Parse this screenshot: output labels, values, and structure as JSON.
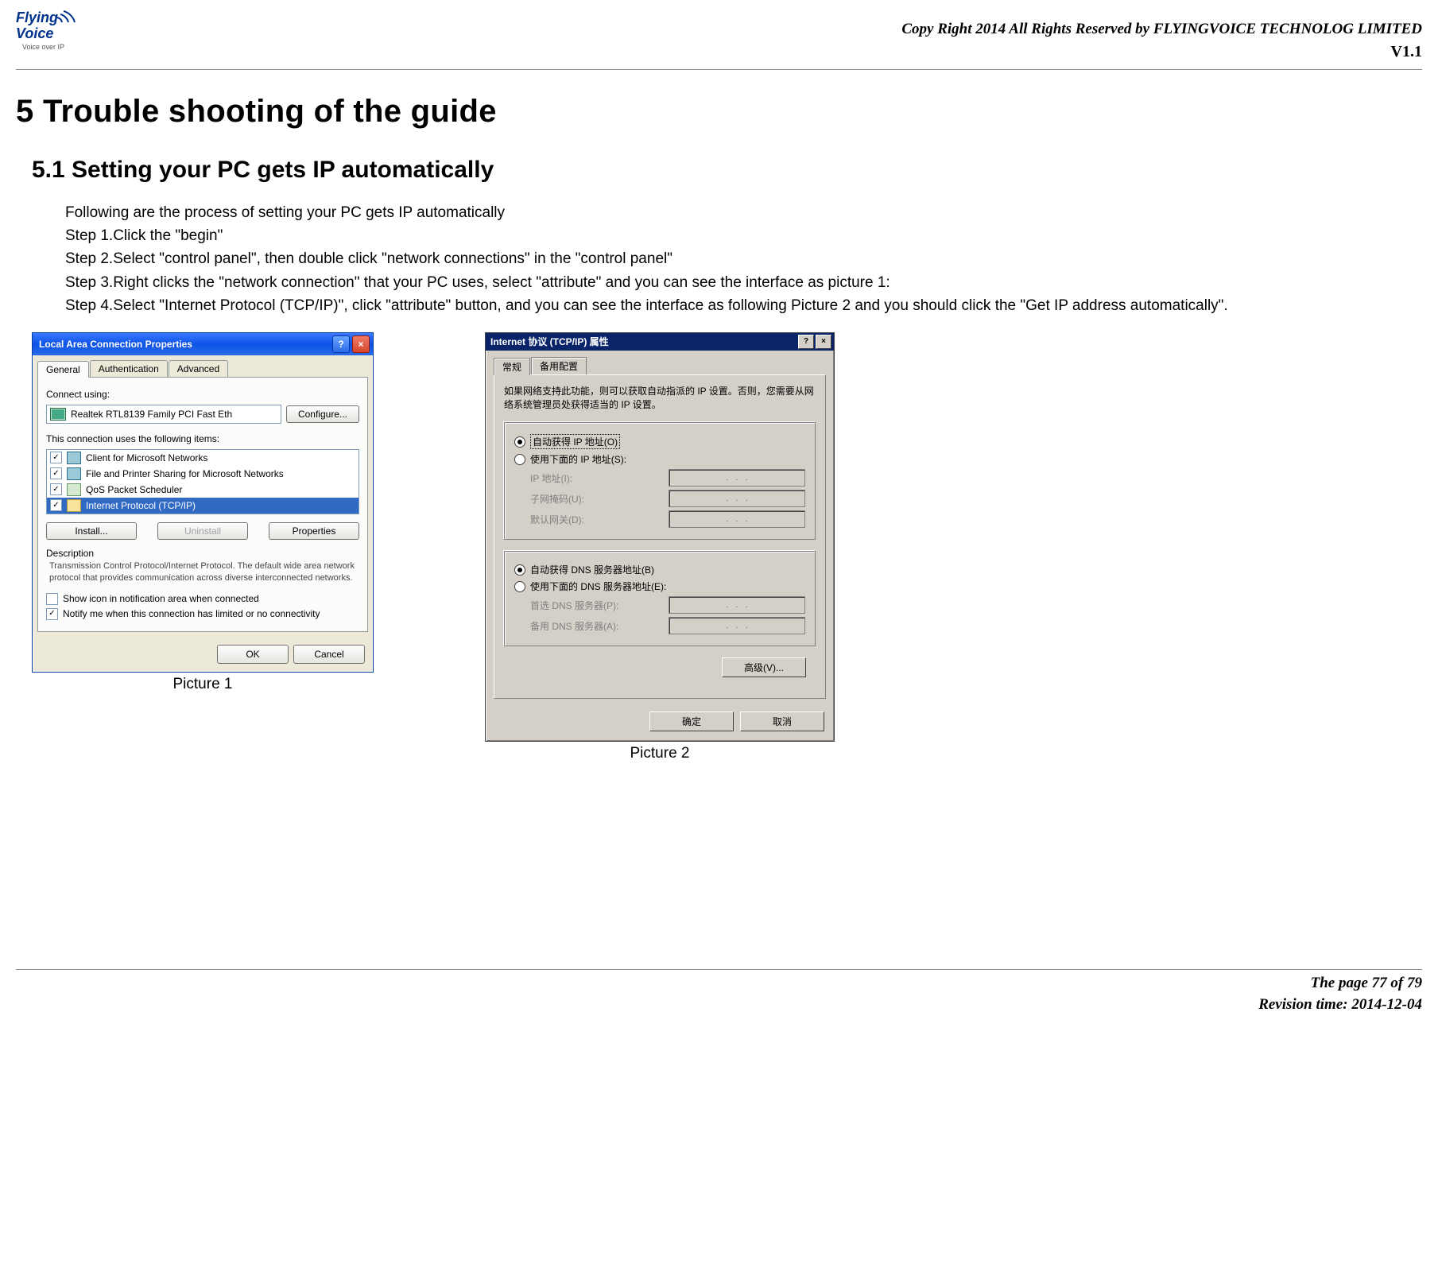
{
  "doc": {
    "copyright": "Copy Right 2014 All Rights Reserved by FLYINGVOICE TECHNOLOG LIMITED",
    "version": "V1.1",
    "footer_page": "The page 77 of 79",
    "footer_rev": "Revision time: 2014-12-04",
    "logo": {
      "line1": "Flying",
      "line2": "Voice",
      "tag": "Voice over IP"
    },
    "h1": "5 Trouble shooting of the guide",
    "h2": "5.1  Setting your PC gets IP automatically",
    "intro": "Following are the process of setting your PC gets IP automatically",
    "step1": "Step 1.Click the \"begin\"",
    "step2": "Step 2.Select \"control panel\", then double click \"network connections\" in the \"control panel\"",
    "step3": "Step 3.Right clicks the \"network connection\" that your PC uses, select \"attribute\" and you can see the interface as picture 1:",
    "step4": "Step 4.Select \"Internet Protocol (TCP/IP)\", click \"attribute\" button, and you can see the interface as following Picture 2    and you should click the \"Get IP address automatically\".",
    "pic1_caption": "Picture 1",
    "pic2_caption": "Picture 2"
  },
  "pic1": {
    "title": "Local Area Connection Properties",
    "help": "?",
    "close": "×",
    "tabs": {
      "general": "General",
      "auth": "Authentication",
      "adv": "Advanced"
    },
    "connect_using_label": "Connect using:",
    "adapter": "Realtek RTL8139 Family PCI Fast Eth",
    "configure": "Configure...",
    "uses_items": "This connection uses the following items:",
    "items": {
      "a": "Client for Microsoft Networks",
      "b": "File and Printer Sharing for Microsoft Networks",
      "c": "QoS Packet Scheduler",
      "d": "Internet Protocol (TCP/IP)"
    },
    "install": "Install...",
    "uninstall": "Uninstall",
    "properties": "Properties",
    "desc_title": "Description",
    "desc_text": "Transmission Control Protocol/Internet Protocol. The default wide area network protocol that provides communication across diverse interconnected networks.",
    "show_icon": "Show icon in notification area when connected",
    "notify": "Notify me when this connection has limited or no connectivity",
    "ok": "OK",
    "cancel": "Cancel"
  },
  "pic2": {
    "title": "Internet 协议 (TCP/IP) 属性",
    "help": "?",
    "close": "×",
    "tabs": {
      "general": "常规",
      "alt": "备用配置"
    },
    "note": "如果网络支持此功能，则可以获取自动指派的 IP 设置。否则，您需要从网络系统管理员处获得适当的 IP 设置。",
    "radio_auto_ip": "自动获得 IP 地址(O)",
    "radio_manual_ip": "使用下面的 IP 地址(S):",
    "ip_label": "IP 地址(I):",
    "mask_label": "子网掩码(U):",
    "gw_label": "默认网关(D):",
    "radio_auto_dns": "自动获得 DNS 服务器地址(B)",
    "radio_manual_dns": "使用下面的 DNS 服务器地址(E):",
    "dns1_label": "首选 DNS 服务器(P):",
    "dns2_label": "备用 DNS 服务器(A):",
    "advanced": "高级(V)...",
    "ok": "确定",
    "cancel": "取消"
  }
}
